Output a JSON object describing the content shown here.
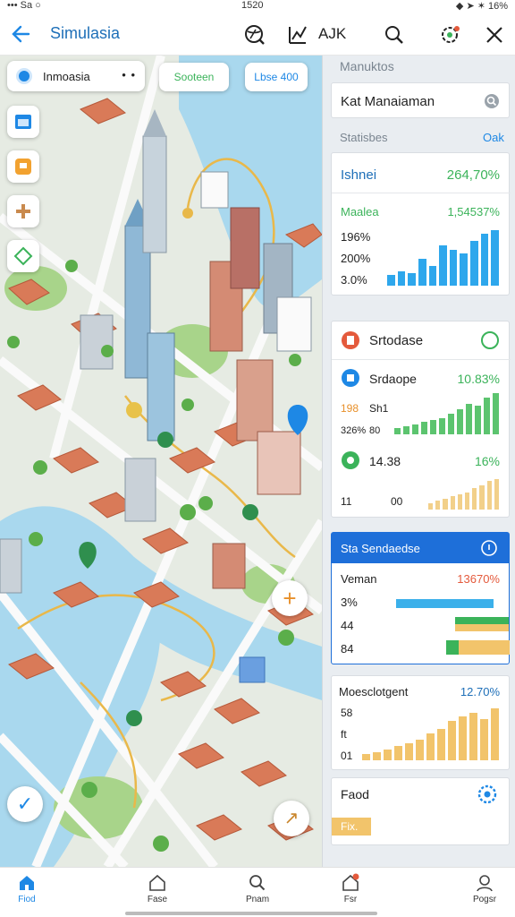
{
  "status_bar": {
    "left": "••• Sa ○",
    "time": "1520",
    "right": "◆ ➤ ✶ 16%"
  },
  "header": {
    "title": "Simulasia",
    "right_text": "AJK",
    "icons": [
      "arrow-left-icon",
      "globe-icon",
      "chart-icon",
      "search-icon",
      "settings-icon",
      "close-icon"
    ]
  },
  "map": {
    "search_label": "Inmoasia",
    "search_menu": "• •",
    "pill_1": "Sooteen",
    "pill_2": "Lbse 400",
    "side_buttons": [
      "calendar-icon",
      "flag-icon",
      "tools-icon",
      "layers-icon"
    ],
    "zoom_label": "+",
    "check_label": "✓",
    "arrow_label": "↗"
  },
  "panel": {
    "section_title": "Manuktos",
    "search_value": "Kat Manaiaman",
    "stats_title": "Statisbes",
    "stats_link": "Oak",
    "card1": {
      "title": "Ishnei",
      "title_value": "264,70%",
      "sub": "Maalea",
      "sub_value": "1,54537%",
      "rows": [
        "196%",
        "200%",
        "3.0%"
      ],
      "bars": [
        12,
        16,
        14,
        30,
        22,
        45,
        40,
        36,
        50,
        58,
        62
      ]
    },
    "card2": {
      "header": "Srtodase",
      "r1_label": "Srdaope",
      "r1_value": "10.83%",
      "r2_a": "198",
      "r2_b": "Sh1",
      "r3_a": "326%",
      "r3_b": "80",
      "r4_label": "14.38",
      "r4_value": "16%",
      "r5_a": "11",
      "r5_b": "00",
      "bars_green": [
        6,
        8,
        10,
        12,
        14,
        16,
        20,
        24,
        30,
        28,
        36,
        40
      ],
      "bars_yellow": [
        6,
        8,
        10,
        12,
        14,
        16,
        20,
        22,
        26,
        28
      ]
    },
    "card3": {
      "header": "Sta Sendaedse",
      "row_label": "Veman",
      "row_value": "13670%",
      "rows": [
        "3%",
        "44",
        "84"
      ],
      "hbars": [
        0.92,
        0.38,
        0.5
      ]
    },
    "card4": {
      "title": "Moesclotgent",
      "value": "12.70%",
      "rows": [
        "58",
        "ft",
        "01"
      ],
      "bars": [
        6,
        8,
        10,
        14,
        16,
        20,
        26,
        30,
        38,
        42,
        46,
        40,
        50
      ]
    },
    "card5": {
      "title": "Faod",
      "badge": "Fix."
    }
  },
  "bottom_nav": [
    {
      "label": "Fiod",
      "icon": "home-icon",
      "active": true
    },
    {
      "label": "Fase",
      "icon": "house-outline-icon",
      "active": false
    },
    {
      "label": "Pnam",
      "icon": "search-icon",
      "active": false
    },
    {
      "label": "Fsr",
      "icon": "bell-house-icon",
      "active": false
    },
    {
      "label": "Pogsr",
      "icon": "profile-icon",
      "active": false
    }
  ],
  "colors": {
    "accent": "#1e88e5",
    "green": "#3bb35a",
    "orange": "#e8902a",
    "red": "#e45a3c",
    "yellow": "#f2c46b"
  }
}
